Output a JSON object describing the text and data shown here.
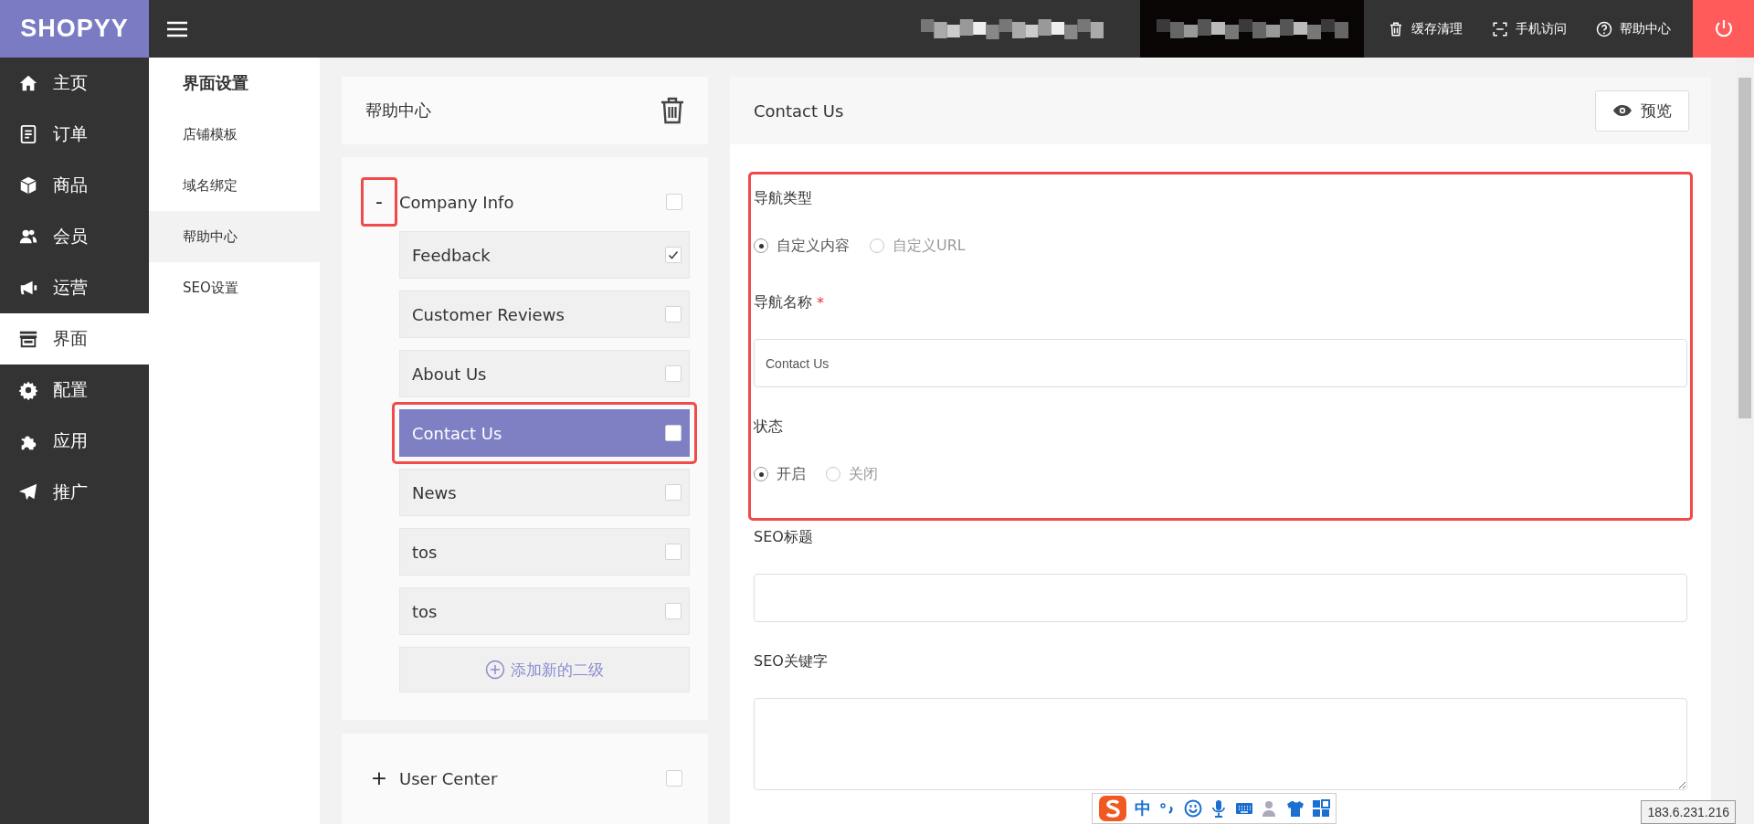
{
  "topbar": {
    "logo": "SHOPYY",
    "actions": [
      {
        "label": "缓存清理"
      },
      {
        "label": "手机访问"
      },
      {
        "label": "帮助中心"
      }
    ]
  },
  "sidebar": {
    "items": [
      {
        "label": "主页",
        "selected": false
      },
      {
        "label": "订单",
        "selected": false
      },
      {
        "label": "商品",
        "selected": false
      },
      {
        "label": "会员",
        "selected": false
      },
      {
        "label": "运营",
        "selected": false
      },
      {
        "label": "界面",
        "selected": true
      },
      {
        "label": "配置",
        "selected": false
      },
      {
        "label": "应用",
        "selected": false
      },
      {
        "label": "推广",
        "selected": false
      }
    ]
  },
  "subnav": {
    "title": "界面设置",
    "items": [
      {
        "label": "店铺模板",
        "selected": false
      },
      {
        "label": "域名绑定",
        "selected": false
      },
      {
        "label": "帮助中心",
        "selected": true
      },
      {
        "label": "SEO设置",
        "selected": false
      }
    ]
  },
  "category_panel": {
    "title": "帮助中心"
  },
  "tree": [
    {
      "label": "Company Info",
      "toggle": "-",
      "checked": false,
      "highlighted": true,
      "add_label": "添加新的二级",
      "children": [
        {
          "label": "Feedback",
          "checked": true,
          "selected": false,
          "highlighted": false
        },
        {
          "label": "Customer Reviews",
          "checked": false,
          "selected": false,
          "highlighted": false
        },
        {
          "label": "About Us",
          "checked": false,
          "selected": false,
          "highlighted": false
        },
        {
          "label": "Contact Us",
          "checked": false,
          "selected": true,
          "highlighted": true
        },
        {
          "label": "News",
          "checked": false,
          "selected": false,
          "highlighted": false
        },
        {
          "label": "tos",
          "checked": false,
          "selected": false,
          "highlighted": false
        },
        {
          "label": "tos",
          "checked": false,
          "selected": false,
          "highlighted": false
        }
      ]
    },
    {
      "label": "User Center",
      "toggle": "+",
      "checked": false
    }
  ],
  "editor": {
    "title": "Contact Us",
    "preview_label": "预览",
    "fields": [
      {
        "kind": "radio",
        "label": "导航类型",
        "highlighted": true,
        "options": [
          {
            "label": "自定义内容",
            "selected": true
          },
          {
            "label": "自定义URL",
            "selected": false
          }
        ]
      },
      {
        "kind": "text",
        "label": "导航名称",
        "required_mark": "*",
        "highlighted": true,
        "value": "Contact Us"
      },
      {
        "kind": "radio",
        "label": "状态",
        "highlighted": true,
        "options": [
          {
            "label": "开启",
            "selected": true
          },
          {
            "label": "关闭",
            "selected": false
          }
        ]
      },
      {
        "kind": "text",
        "label": "SEO标题",
        "highlighted": false
      },
      {
        "kind": "textarea",
        "label": "SEO关键字",
        "highlighted": false
      }
    ]
  },
  "ime_toolbar": {
    "mode": "中"
  },
  "ip_label": "183.6.231.216"
}
